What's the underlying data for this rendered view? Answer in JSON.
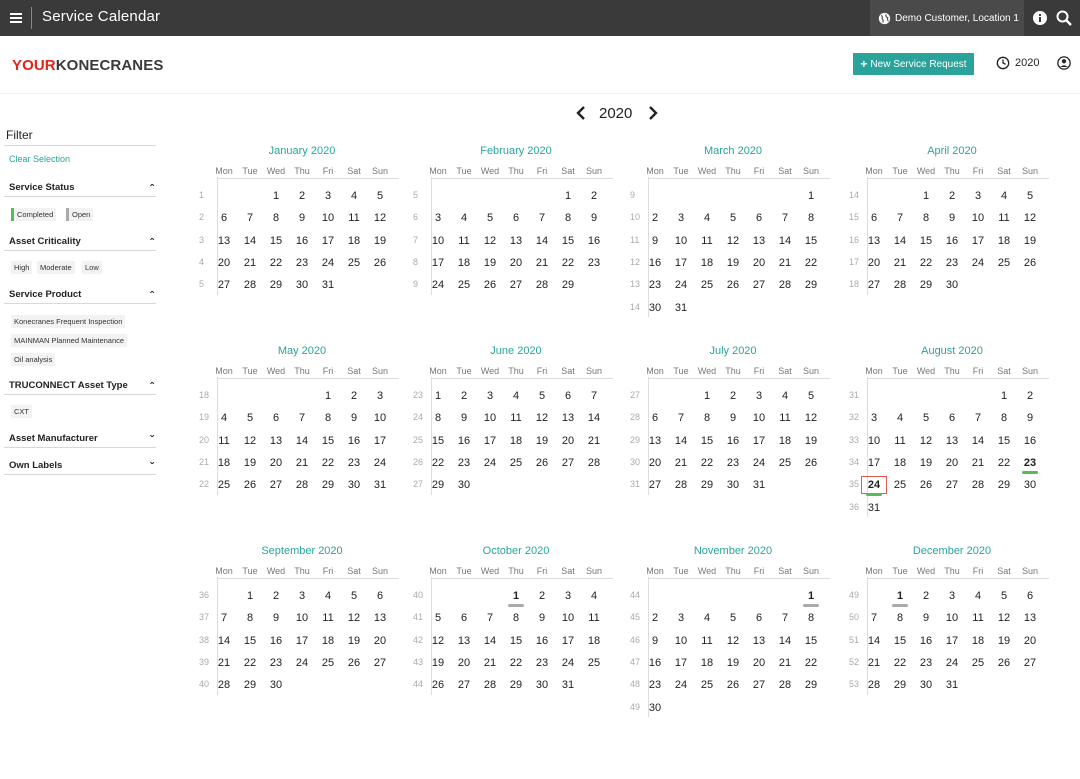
{
  "topbar": {
    "title": "Service Calendar",
    "customer": "Demo Customer, Location 1"
  },
  "brand": {
    "part1": "YOUR",
    "part2": "KONECRANES"
  },
  "header": {
    "new_request_label": "New Service Request",
    "year": "2020"
  },
  "sidebar": {
    "title": "Filter",
    "clear_selection": "Clear Selection",
    "sections": [
      {
        "title": "Service Status",
        "expanded": true,
        "chips": [
          "Completed",
          "Open"
        ]
      },
      {
        "title": "Asset Criticality",
        "expanded": true,
        "chips": [
          "High",
          "Moderate",
          "Low"
        ]
      },
      {
        "title": "Service Product",
        "expanded": true,
        "chips": [
          "Konecranes Frequent Inspection",
          "MAINMAN Planned Maintenance",
          "Oil analysis"
        ]
      },
      {
        "title": "TRUCONNECT Asset Type",
        "expanded": true,
        "chips": [
          "CXT"
        ]
      },
      {
        "title": "Asset Manufacturer",
        "expanded": false,
        "chips": []
      },
      {
        "title": "Own Labels",
        "expanded": false,
        "chips": []
      }
    ]
  },
  "calendar": {
    "year_label": "2020",
    "weekdays": [
      "Mon",
      "Tue",
      "Wed",
      "Thu",
      "Fri",
      "Sat",
      "Sun"
    ],
    "colors": {
      "accent": "#2aa39b",
      "completed": "#5cb85c",
      "open": "#aaaaaa",
      "today": "#e05a4e",
      "brand_red": "#e2231a"
    },
    "months": [
      {
        "name": "January 2020",
        "start": 2,
        "days": 31,
        "weeks": [
          "1",
          "2",
          "3",
          "4",
          "5"
        ],
        "marks": []
      },
      {
        "name": "February 2020",
        "start": 5,
        "days": 29,
        "weeks": [
          "5",
          "6",
          "7",
          "8",
          "9"
        ],
        "marks": []
      },
      {
        "name": "March 2020",
        "start": 6,
        "days": 31,
        "weeks": [
          "9",
          "10",
          "11",
          "12",
          "13",
          "14"
        ],
        "marks": []
      },
      {
        "name": "April 2020",
        "start": 2,
        "days": 30,
        "weeks": [
          "14",
          "15",
          "16",
          "17",
          "18"
        ],
        "marks": []
      },
      {
        "name": "May 2020",
        "start": 4,
        "days": 31,
        "weeks": [
          "18",
          "19",
          "20",
          "21",
          "22"
        ],
        "marks": []
      },
      {
        "name": "June 2020",
        "start": 0,
        "days": 30,
        "weeks": [
          "23",
          "24",
          "25",
          "26",
          "27"
        ],
        "marks": []
      },
      {
        "name": "July 2020",
        "start": 2,
        "days": 31,
        "weeks": [
          "27",
          "28",
          "29",
          "30",
          "31"
        ],
        "marks": []
      },
      {
        "name": "August 2020",
        "start": 5,
        "days": 31,
        "weeks": [
          "31",
          "32",
          "33",
          "34",
          "35",
          "36"
        ],
        "marks": [
          {
            "day": 23,
            "status": "completed"
          },
          {
            "day": 24,
            "status": "completed",
            "today": true
          }
        ]
      },
      {
        "name": "September 2020",
        "start": 1,
        "days": 30,
        "weeks": [
          "36",
          "37",
          "38",
          "39",
          "40"
        ],
        "marks": []
      },
      {
        "name": "October 2020",
        "start": 3,
        "days": 31,
        "weeks": [
          "40",
          "41",
          "42",
          "43",
          "44"
        ],
        "marks": [
          {
            "day": 1,
            "status": "open"
          }
        ]
      },
      {
        "name": "November 2020",
        "start": 6,
        "days": 30,
        "weeks": [
          "44",
          "45",
          "46",
          "47",
          "48",
          "49"
        ],
        "marks": [
          {
            "day": 1,
            "status": "open"
          }
        ]
      },
      {
        "name": "December 2020",
        "start": 1,
        "days": 31,
        "weeks": [
          "49",
          "50",
          "51",
          "52",
          "53"
        ],
        "marks": [
          {
            "day": 1,
            "status": "open"
          }
        ]
      }
    ]
  }
}
